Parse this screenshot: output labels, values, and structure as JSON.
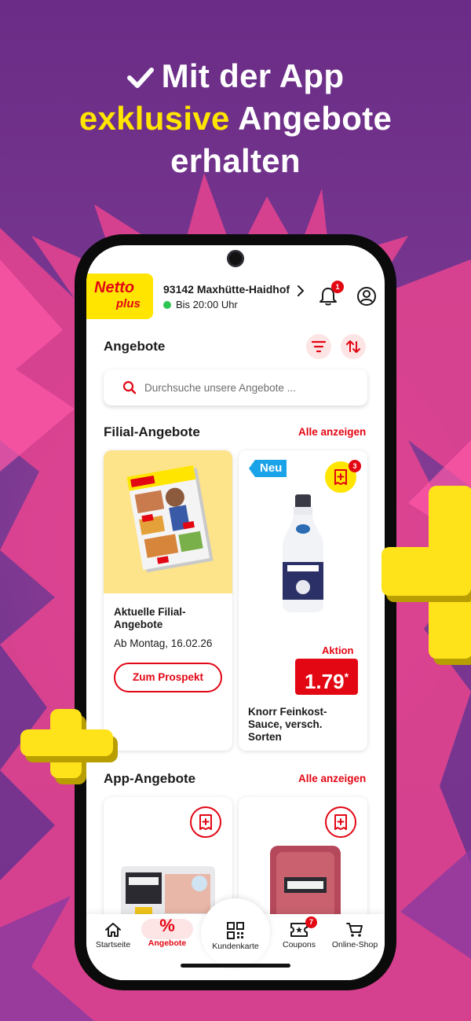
{
  "colors": {
    "background": "#74318c",
    "accent_yellow": "#ffe500",
    "brand_red": "#e30613",
    "online_green": "#2dc653",
    "neu_blue": "#1aa3e8"
  },
  "headline": {
    "check_icon": "check-icon",
    "line1": "Mit der App",
    "line2_highlight": "exklusive",
    "line2_rest": "Angebote",
    "line3": "erhalten"
  },
  "app": {
    "logo": {
      "word1": "Netto",
      "word2": "plus"
    },
    "store": {
      "address": "93142 Maxhütte-Haidhof",
      "hours": "Bis 20:00 Uhr"
    },
    "notifications_count": "1"
  },
  "offers": {
    "title": "Angebote",
    "search_placeholder": "Durchsuche unsere Angebote ..."
  },
  "filial": {
    "title": "Filial-Angebote",
    "show_all": "Alle anzeigen",
    "flyer_card": {
      "title_line1": "Aktuelle Filial-",
      "title_line2": "Angebote",
      "date": "Ab Montag, 16.02.26",
      "button": "Zum Prospekt"
    },
    "product_card": {
      "tag": "Neu",
      "coupon_count": "3",
      "aktion": "Aktion",
      "price": "1.79",
      "price_suffix": "*",
      "name_line1": "Knorr Feinkost-",
      "name_line2": "Sauce, versch.",
      "name_line3": "Sorten"
    }
  },
  "app_offers": {
    "title": "App-Angebote",
    "show_all": "Alle anzeigen"
  },
  "nav": {
    "items": [
      {
        "label": "Startseite",
        "icon": "home-icon"
      },
      {
        "label": "Angebote",
        "icon": "percent-icon",
        "glyph": "%"
      },
      {
        "label": "Kundenkarte",
        "icon": "qr-code-icon"
      },
      {
        "label": "Coupons",
        "icon": "coupon-icon",
        "badge": "7"
      },
      {
        "label": "Online-Shop",
        "icon": "cart-icon"
      }
    ]
  }
}
